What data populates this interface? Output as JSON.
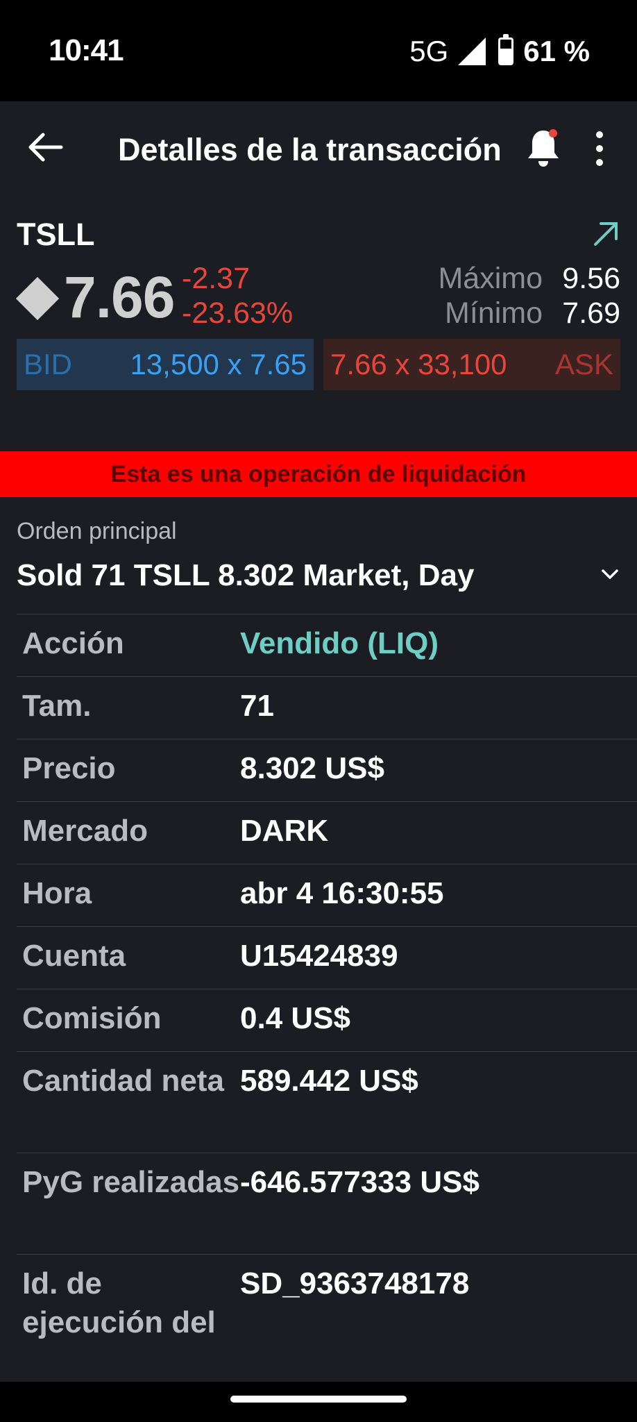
{
  "status_bar": {
    "time": "10:41",
    "network": "5G",
    "battery_percent": "61 %",
    "battery_level": 0.61
  },
  "header": {
    "title": "Detalles de la transacción"
  },
  "quote": {
    "symbol": "TSLL",
    "last_price": "7.66",
    "change": "-2.37",
    "change_percent": "-23.63%",
    "high_label": "Máximo",
    "high_value": "9.56",
    "low_label": "Mínimo",
    "low_value": "7.69",
    "bid_label": "BID",
    "bid_value": "13,500 x 7.65",
    "ask_value": "7.66 x 33,100",
    "ask_label": "ASK"
  },
  "banner": {
    "text": "Esta es una operación de liquidación"
  },
  "order": {
    "label": "Orden principal",
    "summary": "Sold 71 TSLL 8.302 Market, Day"
  },
  "details": [
    {
      "label": "Acción",
      "value": "Vendido (LIQ)"
    },
    {
      "label": "Tam.",
      "value": "71"
    },
    {
      "label": "Precio",
      "value": "8.302 US$"
    },
    {
      "label": "Mercado",
      "value": "DARK"
    },
    {
      "label": "Hora",
      "value": "abr 4 16:30:55"
    },
    {
      "label": "Cuenta",
      "value": "U15424839"
    },
    {
      "label": "Comisión",
      "value": "0.4 US$"
    },
    {
      "label": "Cantidad neta",
      "value": "589.442 US$"
    },
    {
      "label": "PyG realizadas",
      "value": "-646.577333 US$"
    },
    {
      "label": "Id. de ejecución del",
      "value": "SD_9363748178"
    }
  ],
  "colors": {
    "background": "#1b1d22",
    "accent_teal": "#6ecdc4",
    "negative_red": "#e8453c",
    "bid_blue": "#3aa0f2",
    "banner_red": "#ff0000"
  },
  "icons": {
    "back": "arrow-left-icon",
    "notifications": "bell-icon",
    "more": "more-vertical-icon",
    "open": "arrow-up-right-icon",
    "expand": "chevron-down-icon"
  }
}
